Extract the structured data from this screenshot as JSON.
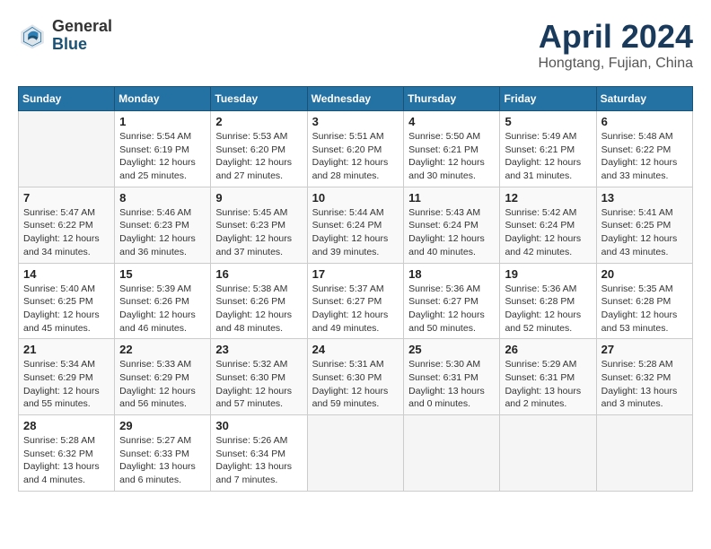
{
  "header": {
    "logo_general": "General",
    "logo_blue": "Blue",
    "month_title": "April 2024",
    "location": "Hongtang, Fujian, China"
  },
  "calendar": {
    "days_of_week": [
      "Sunday",
      "Monday",
      "Tuesday",
      "Wednesday",
      "Thursday",
      "Friday",
      "Saturday"
    ],
    "weeks": [
      [
        {
          "day": "",
          "info": ""
        },
        {
          "day": "1",
          "info": "Sunrise: 5:54 AM\nSunset: 6:19 PM\nDaylight: 12 hours\nand 25 minutes."
        },
        {
          "day": "2",
          "info": "Sunrise: 5:53 AM\nSunset: 6:20 PM\nDaylight: 12 hours\nand 27 minutes."
        },
        {
          "day": "3",
          "info": "Sunrise: 5:51 AM\nSunset: 6:20 PM\nDaylight: 12 hours\nand 28 minutes."
        },
        {
          "day": "4",
          "info": "Sunrise: 5:50 AM\nSunset: 6:21 PM\nDaylight: 12 hours\nand 30 minutes."
        },
        {
          "day": "5",
          "info": "Sunrise: 5:49 AM\nSunset: 6:21 PM\nDaylight: 12 hours\nand 31 minutes."
        },
        {
          "day": "6",
          "info": "Sunrise: 5:48 AM\nSunset: 6:22 PM\nDaylight: 12 hours\nand 33 minutes."
        }
      ],
      [
        {
          "day": "7",
          "info": "Sunrise: 5:47 AM\nSunset: 6:22 PM\nDaylight: 12 hours\nand 34 minutes."
        },
        {
          "day": "8",
          "info": "Sunrise: 5:46 AM\nSunset: 6:23 PM\nDaylight: 12 hours\nand 36 minutes."
        },
        {
          "day": "9",
          "info": "Sunrise: 5:45 AM\nSunset: 6:23 PM\nDaylight: 12 hours\nand 37 minutes."
        },
        {
          "day": "10",
          "info": "Sunrise: 5:44 AM\nSunset: 6:24 PM\nDaylight: 12 hours\nand 39 minutes."
        },
        {
          "day": "11",
          "info": "Sunrise: 5:43 AM\nSunset: 6:24 PM\nDaylight: 12 hours\nand 40 minutes."
        },
        {
          "day": "12",
          "info": "Sunrise: 5:42 AM\nSunset: 6:24 PM\nDaylight: 12 hours\nand 42 minutes."
        },
        {
          "day": "13",
          "info": "Sunrise: 5:41 AM\nSunset: 6:25 PM\nDaylight: 12 hours\nand 43 minutes."
        }
      ],
      [
        {
          "day": "14",
          "info": "Sunrise: 5:40 AM\nSunset: 6:25 PM\nDaylight: 12 hours\nand 45 minutes."
        },
        {
          "day": "15",
          "info": "Sunrise: 5:39 AM\nSunset: 6:26 PM\nDaylight: 12 hours\nand 46 minutes."
        },
        {
          "day": "16",
          "info": "Sunrise: 5:38 AM\nSunset: 6:26 PM\nDaylight: 12 hours\nand 48 minutes."
        },
        {
          "day": "17",
          "info": "Sunrise: 5:37 AM\nSunset: 6:27 PM\nDaylight: 12 hours\nand 49 minutes."
        },
        {
          "day": "18",
          "info": "Sunrise: 5:36 AM\nSunset: 6:27 PM\nDaylight: 12 hours\nand 50 minutes."
        },
        {
          "day": "19",
          "info": "Sunrise: 5:36 AM\nSunset: 6:28 PM\nDaylight: 12 hours\nand 52 minutes."
        },
        {
          "day": "20",
          "info": "Sunrise: 5:35 AM\nSunset: 6:28 PM\nDaylight: 12 hours\nand 53 minutes."
        }
      ],
      [
        {
          "day": "21",
          "info": "Sunrise: 5:34 AM\nSunset: 6:29 PM\nDaylight: 12 hours\nand 55 minutes."
        },
        {
          "day": "22",
          "info": "Sunrise: 5:33 AM\nSunset: 6:29 PM\nDaylight: 12 hours\nand 56 minutes."
        },
        {
          "day": "23",
          "info": "Sunrise: 5:32 AM\nSunset: 6:30 PM\nDaylight: 12 hours\nand 57 minutes."
        },
        {
          "day": "24",
          "info": "Sunrise: 5:31 AM\nSunset: 6:30 PM\nDaylight: 12 hours\nand 59 minutes."
        },
        {
          "day": "25",
          "info": "Sunrise: 5:30 AM\nSunset: 6:31 PM\nDaylight: 13 hours\nand 0 minutes."
        },
        {
          "day": "26",
          "info": "Sunrise: 5:29 AM\nSunset: 6:31 PM\nDaylight: 13 hours\nand 2 minutes."
        },
        {
          "day": "27",
          "info": "Sunrise: 5:28 AM\nSunset: 6:32 PM\nDaylight: 13 hours\nand 3 minutes."
        }
      ],
      [
        {
          "day": "28",
          "info": "Sunrise: 5:28 AM\nSunset: 6:32 PM\nDaylight: 13 hours\nand 4 minutes."
        },
        {
          "day": "29",
          "info": "Sunrise: 5:27 AM\nSunset: 6:33 PM\nDaylight: 13 hours\nand 6 minutes."
        },
        {
          "day": "30",
          "info": "Sunrise: 5:26 AM\nSunset: 6:34 PM\nDaylight: 13 hours\nand 7 minutes."
        },
        {
          "day": "",
          "info": ""
        },
        {
          "day": "",
          "info": ""
        },
        {
          "day": "",
          "info": ""
        },
        {
          "day": "",
          "info": ""
        }
      ]
    ]
  }
}
